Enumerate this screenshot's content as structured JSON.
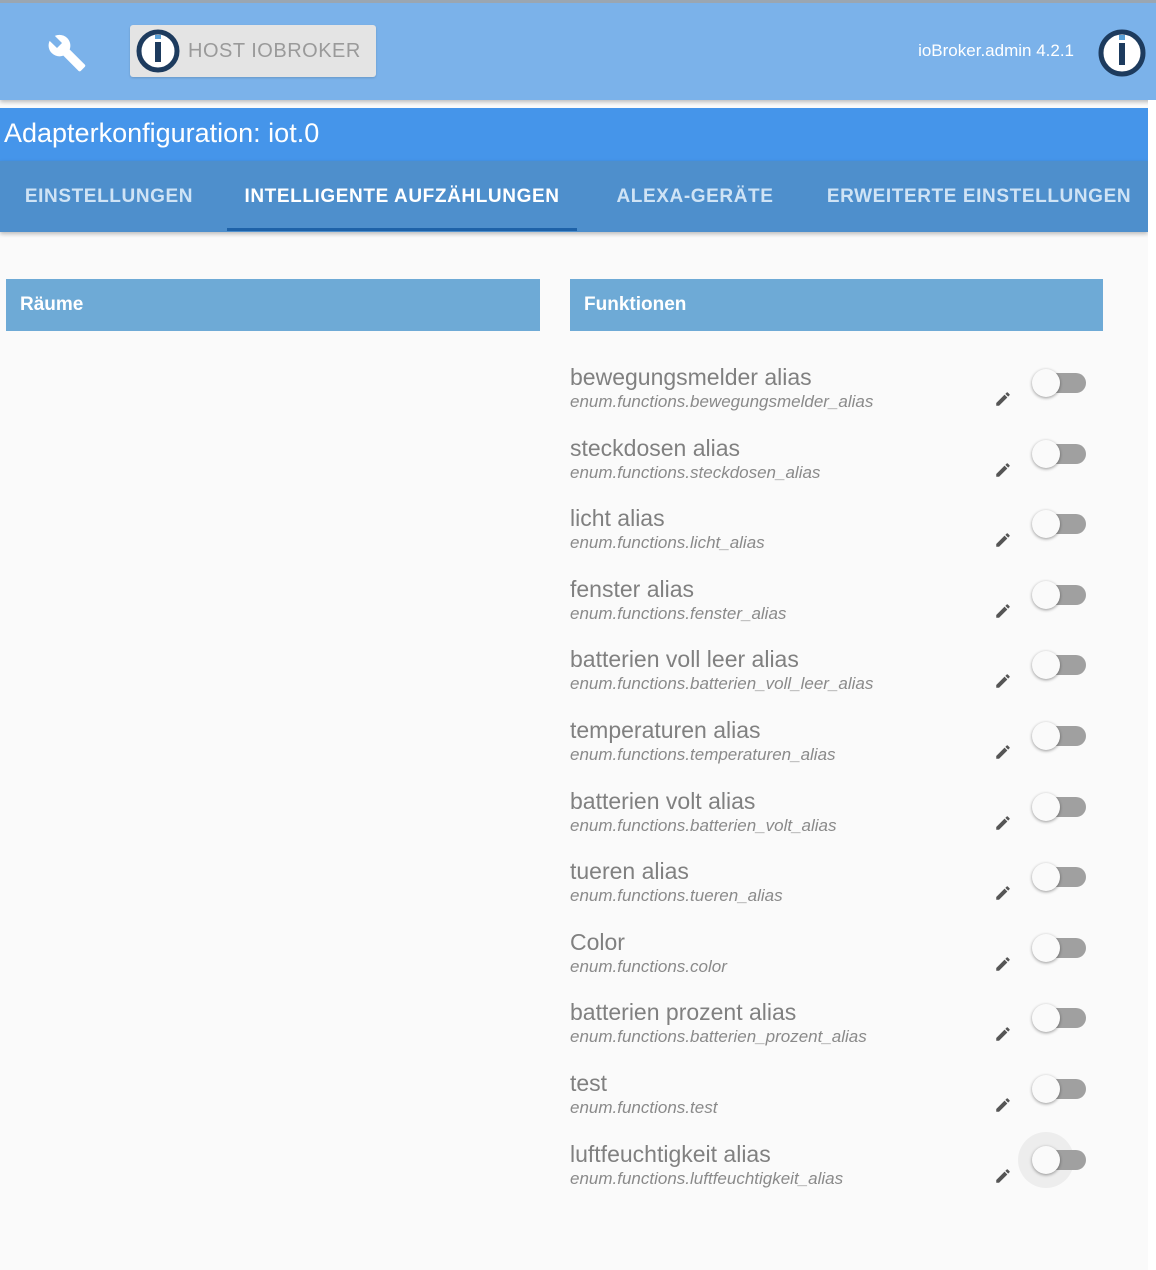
{
  "header": {
    "host_label": "HOST IOBROKER",
    "version": "ioBroker.admin 4.2.1",
    "settings_icon": "wrench-icon",
    "logo_icon": "iobroker-logo-icon"
  },
  "title": "Adapterkonfiguration: iot.0",
  "tabs": [
    {
      "label": "EINSTELLUNGEN",
      "active": false
    },
    {
      "label": "INTELLIGENTE AUFZÄHLUNGEN",
      "active": true
    },
    {
      "label": "ALEXA-GERÄTE",
      "active": false
    },
    {
      "label": "ERWEITERTE EINSTELLUNGEN",
      "active": false
    }
  ],
  "panels": {
    "rooms_title": "Räume",
    "functions_title": "Funktionen"
  },
  "functions": [
    {
      "name": "bewegungsmelder alias",
      "id": "enum.functions.bewegungsmelder_alias",
      "enabled": false
    },
    {
      "name": "steckdosen alias",
      "id": "enum.functions.steckdosen_alias",
      "enabled": false
    },
    {
      "name": "licht alias",
      "id": "enum.functions.licht_alias",
      "enabled": false
    },
    {
      "name": "fenster alias",
      "id": "enum.functions.fenster_alias",
      "enabled": false
    },
    {
      "name": "batterien voll leer alias",
      "id": "enum.functions.batterien_voll_leer_alias",
      "enabled": false
    },
    {
      "name": "temperaturen alias",
      "id": "enum.functions.temperaturen_alias",
      "enabled": false
    },
    {
      "name": "batterien volt alias",
      "id": "enum.functions.batterien_volt_alias",
      "enabled": false
    },
    {
      "name": "tueren alias",
      "id": "enum.functions.tueren_alias",
      "enabled": false
    },
    {
      "name": "Color",
      "id": "enum.functions.color",
      "enabled": false
    },
    {
      "name": "batterien prozent alias",
      "id": "enum.functions.batterien_prozent_alias",
      "enabled": false
    },
    {
      "name": "test",
      "id": "enum.functions.test",
      "enabled": false
    },
    {
      "name": "luftfeuchtigkeit alias",
      "id": "enum.functions.luftfeuchtigkeit_alias",
      "enabled": false
    }
  ],
  "colors": {
    "topbar": "#7bb2ea",
    "titlebar": "#4595ea",
    "tabs": "#4e8fcc",
    "panel_header": "#6eaad6"
  }
}
